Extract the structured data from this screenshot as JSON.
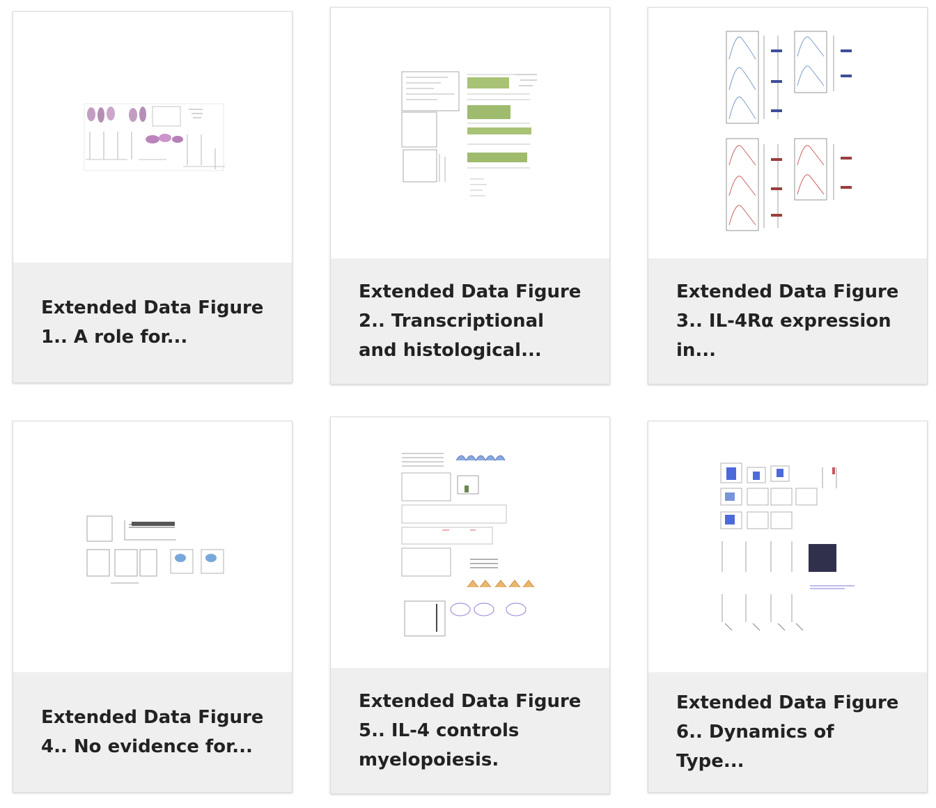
{
  "figures": [
    {
      "caption": "Extended Data Figure 1.. A role for...",
      "thumbnail": "extended-data-figure-1-thumbnail"
    },
    {
      "caption": "Extended Data Figure 2.. Transcriptional and histological...",
      "thumbnail": "extended-data-figure-2-thumbnail"
    },
    {
      "caption": "Extended Data Figure 3.. IL-4Rα expression in...",
      "thumbnail": "extended-data-figure-3-thumbnail"
    },
    {
      "caption": "Extended Data Figure 4.. No evidence for...",
      "thumbnail": "extended-data-figure-4-thumbnail"
    },
    {
      "caption": "Extended Data Figure 5.. IL-4 controls myelopoiesis.",
      "thumbnail": "extended-data-figure-5-thumbnail"
    },
    {
      "caption": "Extended Data Figure 6.. Dynamics of Type...",
      "thumbnail": "extended-data-figure-6-thumbnail"
    }
  ],
  "colors": {
    "card_border": "#dcdcdc",
    "caption_background": "#efefef",
    "caption_text": "#222222",
    "thumbnail_background": "#ffffff"
  }
}
